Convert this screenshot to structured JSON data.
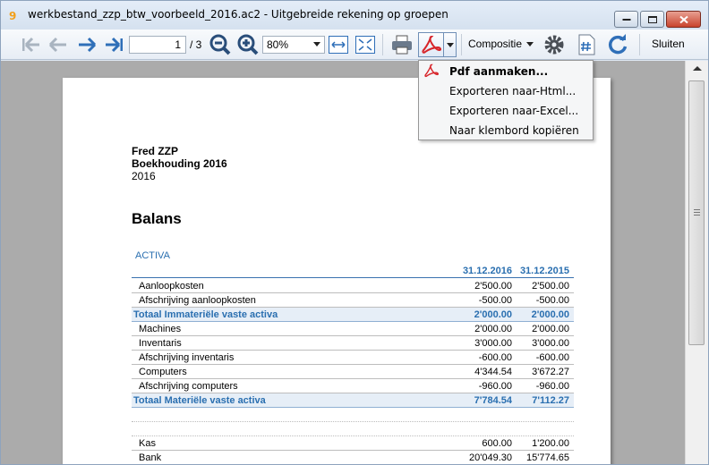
{
  "window": {
    "title": "werkbestand_zzp_btw_voorbeeld_2016.ac2 - Uitgebreide rekening op groepen",
    "logo_text": "9"
  },
  "toolbar": {
    "page_current": "1",
    "page_total": "/ 3",
    "zoom": "80%",
    "composition_label": "Compositie",
    "close_label": "Sluiten"
  },
  "export_menu": {
    "items": [
      {
        "label": "Pdf aanmaken..."
      },
      {
        "label": "Exporteren naar-Html..."
      },
      {
        "label": "Exporteren naar-Excel..."
      },
      {
        "label": "Naar klembord kopiëren"
      }
    ]
  },
  "report": {
    "name": "Fred ZZP",
    "subtitle": "Boekhouding 2016",
    "year": "2016",
    "title": "Balans",
    "section": "ACTIVA",
    "col1": "31.12.2016",
    "col2": "31.12.2015",
    "rows": [
      {
        "label": "Aanloopkosten",
        "v1": "2'500.00",
        "v2": "2'500.00"
      },
      {
        "label": "Afschrijving aanloopkosten",
        "v1": "-500.00",
        "v2": "-500.00"
      },
      {
        "label": "Totaal Immateriële vaste activa",
        "v1": "2'000.00",
        "v2": "2'000.00",
        "total": true
      },
      {
        "label": "Machines",
        "v1": "2'000.00",
        "v2": "2'000.00"
      },
      {
        "label": "Inventaris",
        "v1": "3'000.00",
        "v2": "3'000.00"
      },
      {
        "label": "Afschrijving inventaris",
        "v1": "-600.00",
        "v2": "-600.00"
      },
      {
        "label": "Computers",
        "v1": "4'344.54",
        "v2": "3'672.27"
      },
      {
        "label": "Afschrijving computers",
        "v1": "-960.00",
        "v2": "-960.00"
      },
      {
        "label": "Totaal Materiële vaste activa",
        "v1": "7'784.54",
        "v2": "7'112.27",
        "total": true
      },
      {
        "label": "",
        "v1": "",
        "v2": "",
        "blank": true
      },
      {
        "label": "",
        "v1": "",
        "v2": "",
        "blank": true
      },
      {
        "label": "Kas",
        "v1": "600.00",
        "v2": "1'200.00"
      },
      {
        "label": "Bank",
        "v1": "20'049.30",
        "v2": "15'774.65"
      }
    ]
  },
  "colors": {
    "accent": "#2a6fb0",
    "pdf_red": "#d7252a",
    "nav_blue": "#2f6fb8"
  }
}
